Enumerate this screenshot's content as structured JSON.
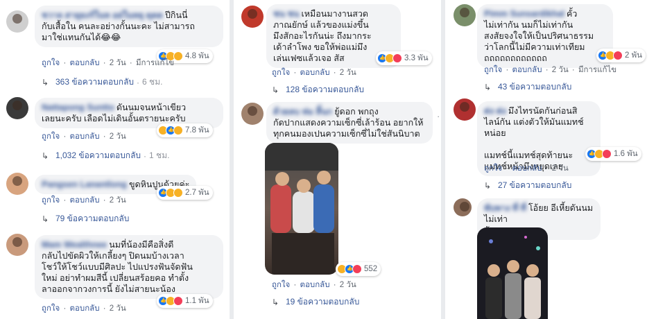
{
  "labels": {
    "like": "ถูกใจ",
    "reply": "ตอบกลับ",
    "sep": "·",
    "edited": "มีการแก้ไข"
  },
  "col1": {
    "c1": {
      "author": "ชวาล สายุยงร์ในห อย่ในหยุ ดุดด",
      "text": "ปีกินนี่\nกับเสื้อใน คนละอย่างกั้นนะคะ ไม่สามารถ\nมาใช่แทนกันได้😂😂",
      "react_count": "4.8 พัน",
      "time": "2 วัน",
      "edited": "มีการแก้ไข",
      "replies": "363 ข้อความตอบกลับ",
      "replies_time": "6 ชม."
    },
    "c2": {
      "author": "Nattapong Suntto",
      "text": "ดันนมจนหน้าเขียว\nเลยนะครับ เลือดไม่เดินอั้นตรายนะครับ",
      "react_count": "7.8 พัน",
      "time": "2 วัน",
      "replies": "1,032 ข้อความตอบกลับ",
      "replies_time": "1 ชม."
    },
    "c3": {
      "author": "Pangsen Lanantlong",
      "text": "ขูดหินปูนด้วยค่ะ",
      "react_count": "2.7 พัน",
      "time": "2 วัน",
      "replies": "79 ข้อความตอบกลับ"
    },
    "c4": {
      "author": "Mam Wealthnee",
      "text": "นมที่น้องมีคือสิ่งดี\nกลับไปขัดผิวให้เกลี้ยงๆ ปิดนมบ้างเวลา\nโชว์ให้โชว์แบบมีศิลปะ ไปแปรงฟันจัดฟัน\nใหม่ อย่าทำผมสีนี้ เปลี่ยนสร้อยคอ ทำตั้ง\nลาออกจากวงการนี้ ยังไม่สายนะน้อง",
      "react_count": "1.1 พัน",
      "time": "2 วัน"
    }
  },
  "col2": {
    "c1": {
      "author": "ชน ชน",
      "text": "เหมือนมางานสวด\nภาณยักษ์ แล้วของแม่งขึ้น\nมึงสักอะไรกันน่ะ ถึงมากระ\nเด้าลำโพง ขอให้พ่อแม่มึง\nเล่นเฟซแล้วเจอ สัส",
      "react_count": "3.3 พัน",
      "time": "2 วัน",
      "replies": "128 ข้อความตอบกลับ"
    },
    "c2": {
      "author": "ด้วยลบ ห่ม สิ้นก",
      "text": "ยู้ดอก พกถุง\nกัดปากแสดงความเซ็กซี่เล้าร้อน อยากให้\nทุกคนมองเปนความเซ็กซี่ไม่ใช่สันนิบาต",
      "react_count": "552",
      "time": "2 วัน",
      "replies": "19 ข้อความตอบกลับ"
    }
  },
  "col3": {
    "c1": {
      "author": "Pimm Sunsardikhal",
      "text": "คั้ว\nไม่เท่ากัน นมก็ไม่เท่ากัน\nสงสัยจงใจให้เป็นปริศนาธรรม\nว่าโลกนี้ไม่มีความเท่าเทียม\nถถถถถถถถถถถถ",
      "react_count": "2 พัน",
      "time": "2 วัน",
      "edited": "มีการแก้ไข",
      "replies": "43 ข้อความตอบกลับ"
    },
    "c2": {
      "author": "ต่ง ต่ง",
      "text": "มึงไทรนัดกันก่อนสิ\nไลน์กัน แต่งตัวให้มันแมทช์\nหน่อย\n\nแมทช์นี้แมทช์สุดท้ายนะ\nแมทช์หน้ามึงหยุดเลย",
      "react_count": "1.6 พัน",
      "time": "2 วัน",
      "replies": "27 ข้อความตอบกลับ"
    },
    "c3": {
      "author": "พับพาง ที่ ที่",
      "text": "โอ้ยย อีเหี้ยดันนมไม่เท่า\nกัน"
    }
  },
  "colors": {
    "link": "#385898",
    "bubble": "#f2f3f5",
    "muted": "#606770",
    "like": "#1877f2",
    "haha": "#f7b125",
    "love": "#f33e58"
  }
}
